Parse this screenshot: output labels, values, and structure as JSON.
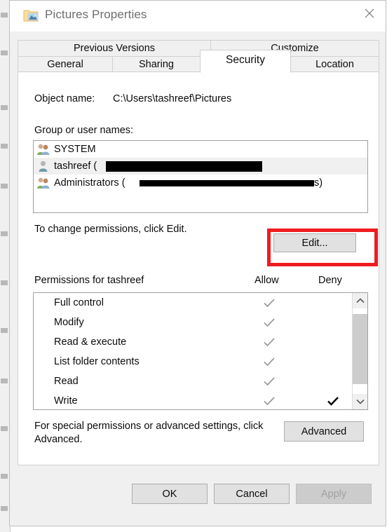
{
  "window": {
    "title": "Pictures Properties",
    "icon": "pictures-folder-icon",
    "close_label": "✕"
  },
  "tabs": [
    {
      "label": "Previous Versions",
      "active": false,
      "row": 1
    },
    {
      "label": "Customize",
      "active": false,
      "row": 1
    },
    {
      "label": "General",
      "active": false,
      "row": 2
    },
    {
      "label": "Sharing",
      "active": false,
      "row": 2
    },
    {
      "label": "Security",
      "active": true,
      "row": 2
    },
    {
      "label": "Location",
      "active": false,
      "row": 2
    }
  ],
  "security": {
    "object_name_label": "Object name:",
    "object_name_value": "C:\\Users\\tashreef\\Pictures",
    "group_label": "Group or user names:",
    "users": [
      {
        "name": "SYSTEM",
        "icon": "group-users-icon",
        "redacted": false,
        "selected": false
      },
      {
        "name": "tashreef (",
        "icon": "single-user-icon",
        "redacted": true,
        "selected": true
      },
      {
        "name": "Administrators (",
        "icon": "group-users-icon",
        "redacted": true,
        "selected": false,
        "suffix": "s)"
      }
    ],
    "edit_hint": "To change permissions, click Edit.",
    "edit_label": "Edit...",
    "permissions_label": "Permissions for tashreef",
    "allow_label": "Allow",
    "deny_label": "Deny",
    "permissions": [
      {
        "name": "Full control",
        "allow": "checked-gray",
        "deny": "none"
      },
      {
        "name": "Modify",
        "allow": "checked-gray",
        "deny": "none"
      },
      {
        "name": "Read & execute",
        "allow": "checked-gray",
        "deny": "none"
      },
      {
        "name": "List folder contents",
        "allow": "checked-gray",
        "deny": "none"
      },
      {
        "name": "Read",
        "allow": "checked-gray",
        "deny": "none"
      },
      {
        "name": "Write",
        "allow": "checked-gray",
        "deny": "checked-black"
      }
    ],
    "advanced_hint": "For special permissions or advanced settings, click Advanced.",
    "advanced_label": "Advanced"
  },
  "footer": {
    "ok_label": "OK",
    "cancel_label": "Cancel",
    "apply_label": "Apply",
    "apply_disabled": true
  },
  "annotation": {
    "type": "red-rectangle-highlight",
    "target": "edit-button",
    "color": "#ee1c20"
  },
  "colors": {
    "dialog_background": "#f0f0f0",
    "tab_page_background": "#ffffff",
    "button_face": "#e1e1e1",
    "selected_row": "#f0f0f0",
    "allow_check": "#9a9a9a",
    "deny_check": "#000000",
    "highlight": "#ee1c20"
  }
}
